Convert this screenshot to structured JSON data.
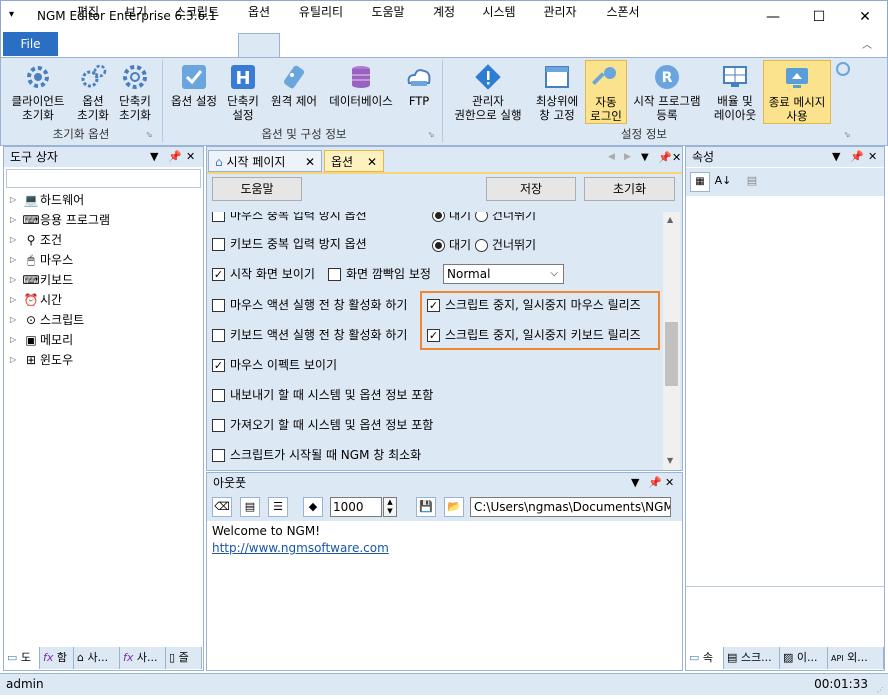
{
  "window": {
    "app_name": "NGM Editor",
    "edition": "Enterprise 6.3.6.1",
    "minimize": "—",
    "maximize": "☐",
    "close": "✕"
  },
  "menu": {
    "file": "File",
    "items": [
      "편집",
      "보기",
      "스크립트",
      "옵션",
      "유틸리티",
      "도움말",
      "계정",
      "시스템",
      "관리자",
      "스폰서"
    ]
  },
  "ribbon": {
    "buttons": [
      {
        "label1": "클라이언트",
        "label2": "초기화"
      },
      {
        "label1": "옵션",
        "label2": "초기화"
      },
      {
        "label1": "단축키",
        "label2": "초기화"
      },
      {
        "label1": "옵션 설정",
        "label2": ""
      },
      {
        "label1": "단축키",
        "label2": "설정"
      },
      {
        "label1": "원격 제어",
        "label2": ""
      },
      {
        "label1": "데이터베이스",
        "label2": ""
      },
      {
        "label1": "FTP",
        "label2": ""
      },
      {
        "label1": "관리자",
        "label2": "권한으로 실행"
      },
      {
        "label1": "최상위에",
        "label2": "창 고정"
      },
      {
        "label1": "자동",
        "label2": "로그인"
      },
      {
        "label1": "시작 프로그램",
        "label2": "등록"
      },
      {
        "label1": "배율 및",
        "label2": "레이아웃"
      },
      {
        "label1": "종료 메시지",
        "label2": "사용"
      }
    ],
    "groups": [
      "초기화 옵션",
      "옵션 및 구성 정보",
      "설정 정보"
    ]
  },
  "toolbox": {
    "title": "도구 상자",
    "items": [
      "하드웨어",
      "응용 프로그램",
      "조건",
      "마우스",
      "키보드",
      "시간",
      "스크립트",
      "메모리",
      "윈도우"
    ],
    "bottom_tabs": [
      "도",
      "함",
      "사...",
      "사...",
      "즐"
    ]
  },
  "docs": {
    "tabs": [
      "시작 페이지",
      "옵션"
    ]
  },
  "options": {
    "help": "도움말",
    "save": "저장",
    "reset": "초기화",
    "partial_top": "마우스 중복 입력 방지 옵션",
    "wait": "대기",
    "skip": "건너뛰기",
    "kb_dup": "키보드 중복 입력 방지 옵션",
    "show_start": "시작 화면 보이기",
    "screen_blink": "화면 깜빡임 보정",
    "blink_value": "Normal",
    "mouse_action": "마우스 액션 실행 전 창 활성화 하기",
    "kb_action": "키보드 액션 실행 전 창 활성화 하기",
    "release_mouse": "스크립트 중지, 일시중지 마우스 릴리즈",
    "release_kb": "스크립트 중지, 일시중지 키보드 릴리즈",
    "mouse_effect": "마우스 이펙트 보이기",
    "export_info": "내보내기 할 때 시스템 및 옵션 정보 포함",
    "import_info": "가져오기 할 때 시스템 및 옵션 정보 포함",
    "minimize_start": "스크립트가 시작될 때 NGM 창 최소화"
  },
  "output": {
    "title": "아웃풋",
    "count": "1000",
    "path": "C:\\Users\\ngmas\\Documents\\NGM6\\",
    "welcome": "Welcome to NGM!",
    "link": "http://www.ngmsoftware.com"
  },
  "properties": {
    "title": "속성",
    "bottom_tabs": [
      "속",
      "스크...",
      "이...",
      "외..."
    ]
  },
  "status": {
    "user": "admin",
    "time": "00:01:33"
  },
  "colors": {
    "accent": "#2b6fc4",
    "panel": "#dde8f5",
    "highlight": "#f0862e"
  }
}
